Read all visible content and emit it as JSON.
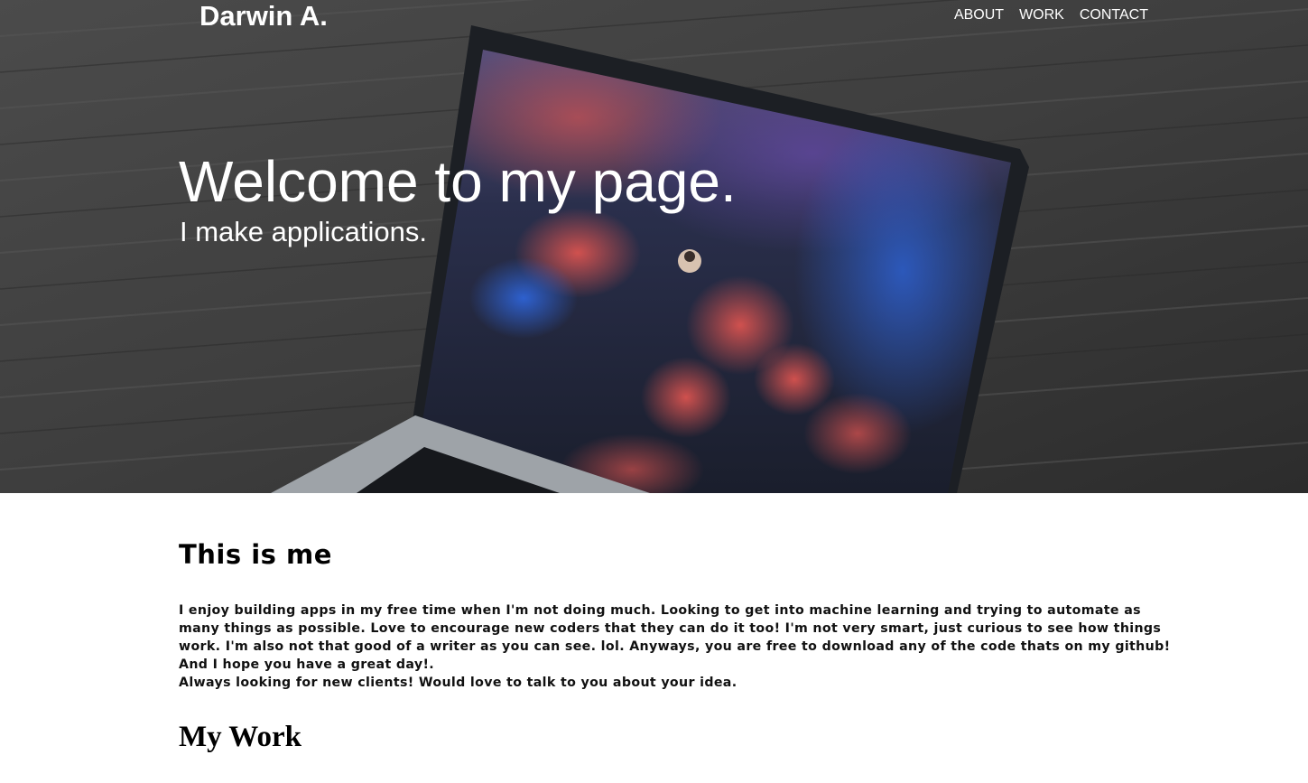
{
  "header": {
    "brand": "Darwin A.",
    "nav": [
      {
        "label": "ABOUT"
      },
      {
        "label": "WORK"
      },
      {
        "label": "CONTACT"
      }
    ]
  },
  "hero": {
    "title": "Welcome to my page.",
    "subtitle": "I make applications.",
    "background_icon": "laptop-photo"
  },
  "about": {
    "title": "This is me",
    "body": "I enjoy building apps in my free time when I'm not doing much. Looking to get into machine learning and trying to automate as many things as possible. Love to encourage new coders that they can do it too! I'm not very smart, just curious to see how things work. I'm also not that good of a writer as you can see. lol. Anyways, you are free to download any of the code thats on my github! And I hope you have a great day!.",
    "cta": "Always looking for new clients! Would love to talk to you about your idea."
  },
  "work": {
    "title": "My Work"
  },
  "colors": {
    "hero_overlay": "#2f3438",
    "text_light": "#ffffff",
    "text_dark": "#111111"
  }
}
